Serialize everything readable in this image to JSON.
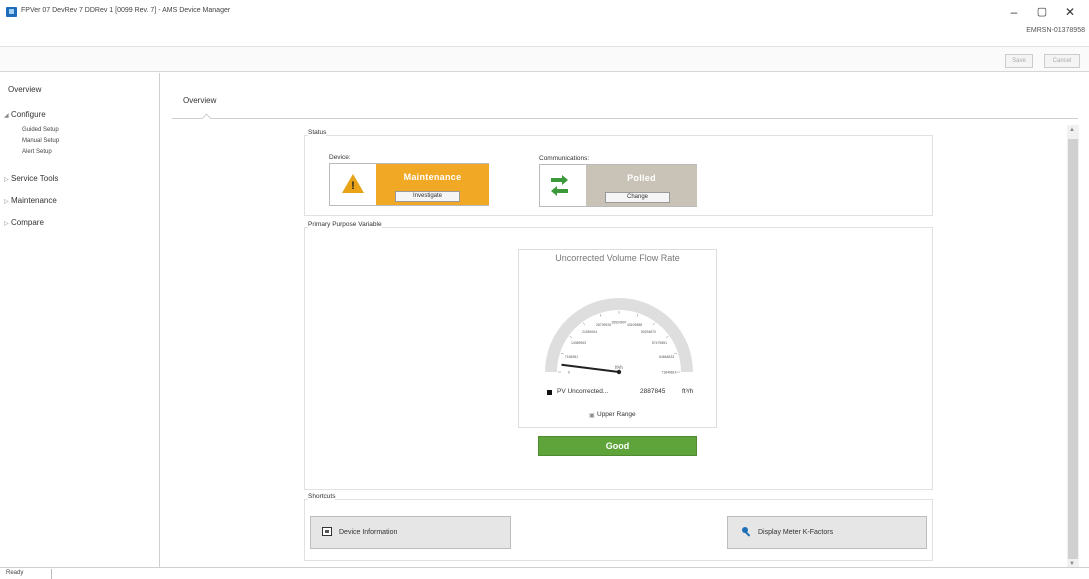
{
  "window": {
    "title": "FPVer 07 DevRev 7 DDRev 1 [0099 Rev. 7] - AMS Device Manager",
    "device_id": "EMRSN-01378958",
    "minimize_glyph": "–",
    "maximize_glyph": "▢",
    "close_glyph": "✕"
  },
  "toolbar": {
    "save_label": "Save",
    "cancel_label": "Cancel"
  },
  "sidebar": {
    "overview": "Overview",
    "configure": "Configure",
    "configure_children": [
      "Guided Setup",
      "Manual Setup",
      "Alert Setup"
    ],
    "service_tools": "Service Tools",
    "maintenance": "Maintenance",
    "compare": "Compare"
  },
  "main": {
    "tab": "Overview",
    "status": {
      "group_label": "Status",
      "device_label": "Device:",
      "device_state": "Maintenance",
      "device_button": "Investigate",
      "device_color": "#f0a825",
      "comm_label": "Communications:",
      "comm_state": "Polled",
      "comm_button": "Change",
      "comm_color": "#c9c3b7"
    },
    "ppv": {
      "group_label": "Primary Purpose Variable",
      "gauge_title": "Uncorrected Volume Flow Rate",
      "gauge_unit": "ft³/h",
      "ticks": [
        "0",
        "7184981",
        "14369963",
        "21554944",
        "28739926",
        "35924907",
        "43109888",
        "50294870",
        "57479851",
        "64664833",
        "71849814"
      ],
      "legend_name": "PV Uncorrected...",
      "legend_value": "2887845",
      "legend_unit": "ft³/h",
      "range_label": "Upper Range",
      "quality": "Good",
      "quality_color": "#5ea43b"
    },
    "shortcuts": {
      "group_label": "Shortcuts",
      "device_info": "Device Information",
      "meter_factors": "Display Meter K-Factors"
    }
  },
  "statusbar": {
    "text": "Ready"
  },
  "icons": [
    "app-icon",
    "warning-icon",
    "comm-arrows-icon",
    "document-icon",
    "key-icon",
    "expand-caret-icon"
  ]
}
